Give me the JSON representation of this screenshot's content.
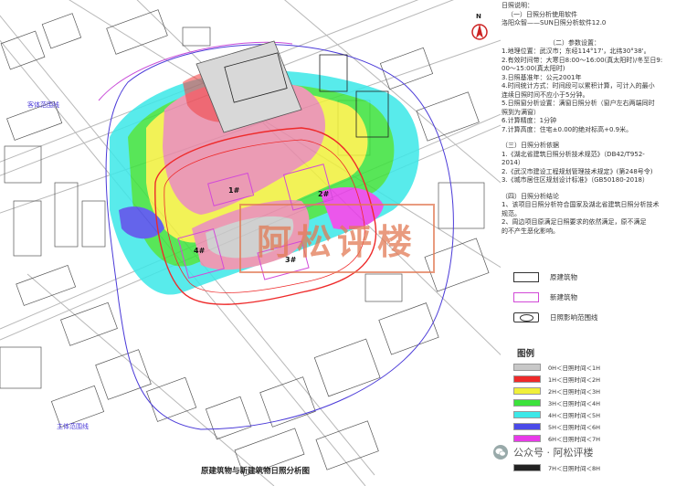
{
  "header": {
    "title": "日照说明：",
    "software_heading": "（一）日照分析使用软件",
    "software_name": "洛阳众智——SUN日照分析软件12.0"
  },
  "compass": {
    "label": "N"
  },
  "parameters": {
    "heading": "（二）参数设置：",
    "items": [
      "1.地理位置：武汉市；东经114°17'，北纬30°38'。",
      "2.有效时间带：大寒日8:00～16:00(真太阳时)/冬至日9:",
      "00～15:00(真太阳时)",
      "3.日照基准年：公元2001年",
      "4.时间统计方式：时间段可以累积计算，可计入的最小",
      "连续日照时间不应小于5分钟。",
      "5.日照窗分析设置：满窗日照分析（窗户左右两端同时",
      "照到为满窗）",
      "6.计算精度：1分钟",
      "7.计算高度：住宅±0.00的绝对标高+0.9米。"
    ]
  },
  "basis": {
    "heading": "（三）日照分析依据",
    "items": [
      "1.《湖北省建筑日照分析技术规范》（DB42/T952-",
      "2014）",
      "2.《武汉市建设工程规划管理技术规定》(第248号令)",
      "3.《城市居住区规划设计标准》（GB50180-2018）"
    ]
  },
  "conclusion": {
    "heading": "（四）日照分析结论",
    "items": [
      "1、该项目日照分析符合国家及湖北省建筑日照分析技术",
      "规范。",
      "2、周边项目原满足日照要求的依然满足，原不满足",
      "的不产生恶化影响。"
    ]
  },
  "legend": {
    "items": [
      {
        "label": "原建筑物",
        "color": "#333333",
        "style": "solid"
      },
      {
        "label": "新建筑物",
        "color": "#d24ad8",
        "style": "solid"
      },
      {
        "label": "日照影响范围线",
        "color": "#333333",
        "style": "ellipse"
      }
    ]
  },
  "hours_legend": {
    "title": "图例",
    "items": [
      {
        "label": "0H＜日照时间＜1H",
        "color": "#c8c8c8"
      },
      {
        "label": "1H＜日照时间＜2H",
        "color": "#ee2a2a"
      },
      {
        "label": "2H＜日照时间＜3H",
        "color": "#f0f03a"
      },
      {
        "label": "3H＜日照时间＜4H",
        "color": "#3ce23c"
      },
      {
        "label": "4H＜日照时间＜5H",
        "color": "#3ce8e8"
      },
      {
        "label": "5H＜日照时间＜6H",
        "color": "#4a4ae8"
      },
      {
        "label": "6H＜日照时间＜7H",
        "color": "#e83ae8"
      },
      {
        "label": "7H＜日照时间＜8H",
        "color": "#222222"
      }
    ]
  },
  "map": {
    "buildings": [
      "1#",
      "2#",
      "3#",
      "4#"
    ],
    "places": [
      "客体范围线",
      "主体范围线"
    ],
    "watermark": "阿松评楼"
  },
  "caption": "原建筑物与新建筑物日照分析图",
  "wechat": {
    "text": "公众号 · 阿松评楼"
  }
}
